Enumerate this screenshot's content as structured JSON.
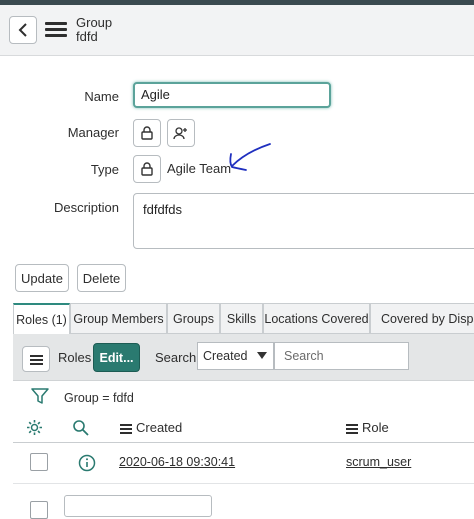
{
  "header": {
    "title": "Group",
    "subtitle": "fdfd"
  },
  "form": {
    "name_label": "Name",
    "name_value": "Agile",
    "manager_label": "Manager",
    "type_label": "Type",
    "type_value": "Agile Team",
    "description_label": "Description",
    "description_value": "fdfdfds"
  },
  "actions": {
    "update": "Update",
    "delete": "Delete"
  },
  "tabs": [
    {
      "label": "Roles (1)"
    },
    {
      "label": "Group Members"
    },
    {
      "label": "Groups"
    },
    {
      "label": "Skills"
    },
    {
      "label": "Locations Covered"
    },
    {
      "label": "Covered by Dispatc"
    }
  ],
  "list": {
    "title": "Roles",
    "edit_label": "Edit...",
    "search_label": "Search",
    "search_field": "Created",
    "search_placeholder": "Search",
    "filter_text": "Group = fdfd",
    "columns": [
      "Created",
      "Role"
    ],
    "rows": [
      {
        "created": "2020-06-18 09:30:41",
        "role": "scrum_user"
      }
    ]
  },
  "colors": {
    "accent": "#2a7a70",
    "focus": "#5ba39a",
    "annotation": "#1f2fbf"
  }
}
